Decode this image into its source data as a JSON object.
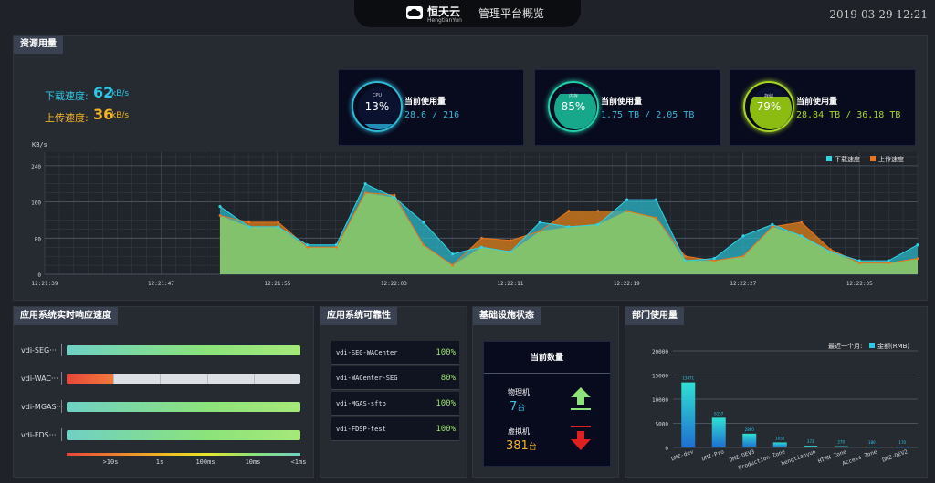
{
  "header": {
    "logo_text": "恒天云",
    "logo_sub": "HengtianYun",
    "title": "管理平台概览",
    "datetime": "2019-03-29  12:21"
  },
  "resource": {
    "title": "资源用量",
    "download_label": "下载速度:",
    "download_value": "62",
    "download_unit": "kB/s",
    "upload_label": "上传速度:",
    "upload_value": "36",
    "upload_unit": "kB/s",
    "cards": [
      {
        "pct_label": "CPU",
        "pct": "13%",
        "fill": 0.13,
        "title": "当前使用量",
        "value": "28.6 / 216",
        "ring_color": "#2fb9d6",
        "fill_color": "#1f8fb8",
        "value_color": "#2fb9d6"
      },
      {
        "pct_label": "内存",
        "pct": "85%",
        "fill": 0.85,
        "title": "当前使用量",
        "value": "1.75 TB / 2.05 TB",
        "ring_color": "#23d0a7",
        "fill_color": "#17a88b",
        "value_color": "#2fb9d6"
      },
      {
        "pct_label": "存储",
        "pct": "79%",
        "fill": 0.79,
        "title": "当前使用量",
        "value": "28.84 TB / 36.18 TB",
        "ring_color": "#a6d624",
        "fill_color": "#8cbc12",
        "value_color": "#a6d624"
      }
    ]
  },
  "chart_data": [
    {
      "type": "area",
      "ylabel": "KB/s",
      "ylim": [
        0,
        270
      ],
      "yticks": [
        "0",
        "80",
        "160",
        "240"
      ],
      "xticks": [
        "12:21:39",
        "12:21:47",
        "12:21:55",
        "12:22:03",
        "12:22:11",
        "12:22:19",
        "12:22:27",
        "12:22:35"
      ],
      "legend": [
        "下载速度",
        "上传速度"
      ],
      "colors": {
        "download": "#2fd4e6",
        "upload": "#e8741e"
      },
      "series": [
        {
          "name": "下载速度",
          "values": [
            150,
            105,
            105,
            65,
            65,
            200,
            170,
            115,
            45,
            60,
            50,
            115,
            105,
            110,
            165,
            165,
            30,
            35,
            85,
            110,
            85,
            50,
            30,
            30,
            65
          ]
        },
        {
          "name": "上传速度",
          "values": [
            130,
            115,
            115,
            60,
            60,
            180,
            175,
            65,
            20,
            80,
            75,
            95,
            140,
            140,
            140,
            125,
            40,
            30,
            40,
            105,
            115,
            55,
            25,
            25,
            35
          ]
        }
      ]
    },
    {
      "type": "bar",
      "title": "最近一个月:",
      "legend": "金额(RMB)",
      "yticks": [
        "0",
        "5000",
        "10000",
        "15000",
        "20000"
      ],
      "ylim": [
        0,
        20000
      ],
      "categories": [
        "DMZ-dev",
        "DMZ-Pro",
        "DMZ-DEV3",
        "Production Zone",
        "hengtianyun",
        "HTMN Zone",
        "Access Zone",
        "DMZ-DEV2"
      ],
      "values": [
        13471,
        6157,
        2860,
        1052,
        372,
        270,
        180,
        170
      ],
      "labels": [
        "13471",
        "6157",
        "2860",
        "1052",
        "372",
        "270",
        "180",
        "170"
      ]
    }
  ],
  "response": {
    "title": "应用系统实时响应速度",
    "rows": [
      {
        "label": "vdi-SEG···",
        "status": "green"
      },
      {
        "label": "vdi-WAC···",
        "status": "partial"
      },
      {
        "label": "vdi-MGAS···",
        "status": "green"
      },
      {
        "label": "vdi-FDS···",
        "status": "green"
      }
    ],
    "scale": [
      ">10s",
      "1s",
      "100ms",
      "10ms",
      "<1ms"
    ]
  },
  "reliability": {
    "title": "应用系统可靠性",
    "rows": [
      {
        "name": "vdi-SEG-WACenter",
        "pct": "100%"
      },
      {
        "name": "vdi-WACenter-SEG",
        "pct": "80%"
      },
      {
        "name": "vdi-MGAS-sftp",
        "pct": "100%"
      },
      {
        "name": "vdi-FDSP-test",
        "pct": "100%"
      }
    ]
  },
  "infra": {
    "title": "基础设施状态",
    "box_title": "当前数量",
    "physical_label": "物理机",
    "physical_value": "7",
    "physical_unit": "台",
    "virtual_label": "虚拟机",
    "virtual_value": "381",
    "virtual_unit": "台"
  },
  "dept": {
    "title": "部门使用量"
  }
}
